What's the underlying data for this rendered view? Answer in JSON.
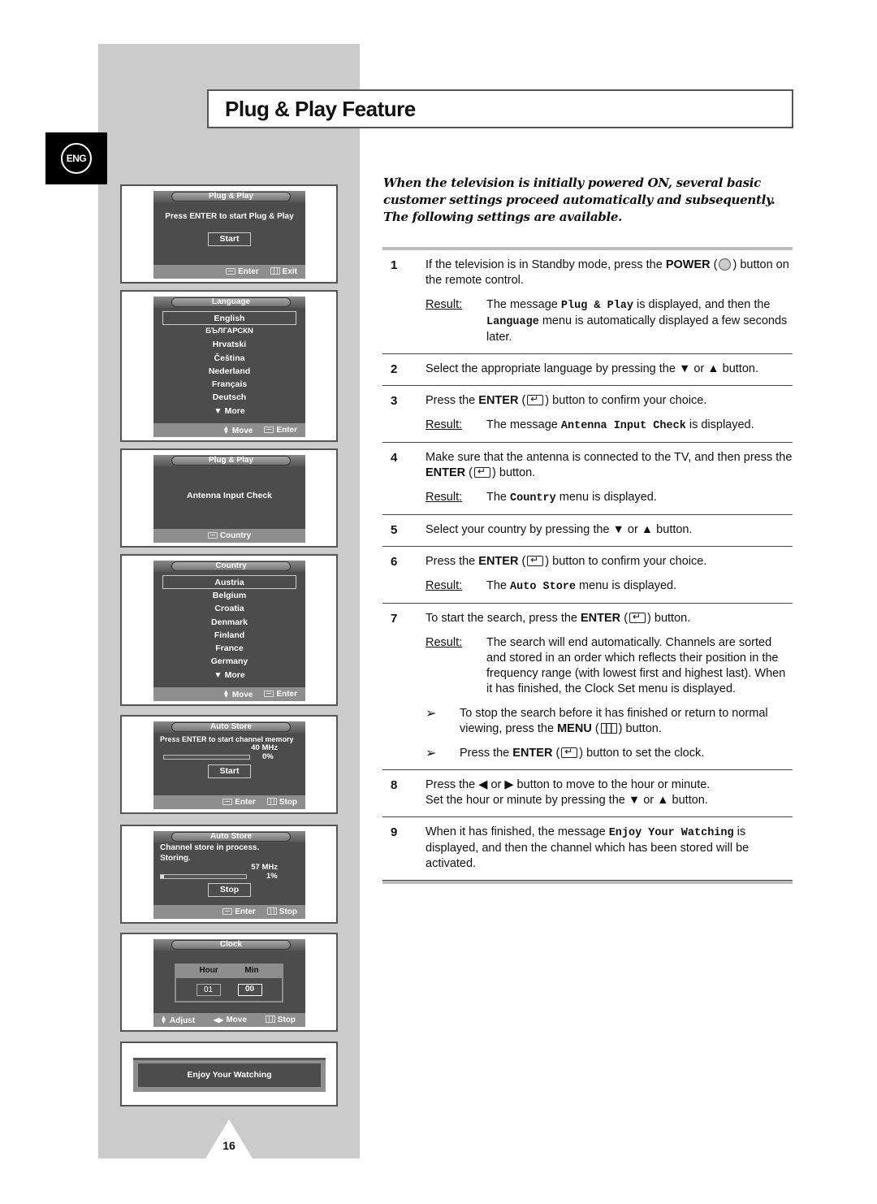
{
  "page": {
    "title": "Plug & Play Feature",
    "language_badge": "ENG",
    "page_number": "16"
  },
  "intro": "When the television is initially powered ON, several basic customer settings proceed automatically and subsequently. The following settings are available.",
  "screens": {
    "plug_play_start": {
      "title": "Plug & Play",
      "message": "Press ENTER to start Plug & Play",
      "button": "Start",
      "footer": [
        "Enter",
        "Exit"
      ]
    },
    "language": {
      "title": "Language",
      "items": [
        "English",
        "БЪЛГАРСКN",
        "Hrvatski",
        "Čeština",
        "Nederland",
        "Français",
        "Deutsch"
      ],
      "selected": "English",
      "more": "▼ More",
      "footer": [
        "Move",
        "Enter"
      ]
    },
    "antenna_check": {
      "title": "Plug & Play",
      "message": "Antenna Input Check",
      "footer": [
        "Country"
      ]
    },
    "country": {
      "title": "Country",
      "items": [
        "Austria",
        "Belgium",
        "Croatia",
        "Denmark",
        "Finland",
        "France",
        "Germany"
      ],
      "selected": "Austria",
      "more": "▼ More",
      "footer": [
        "Move",
        "Enter"
      ]
    },
    "auto_store_start": {
      "title": "Auto Store",
      "message": "Press ENTER to start channel memory",
      "frequency": "40 MHz",
      "progress_label": "0%",
      "progress": 0,
      "button": "Start",
      "footer": [
        "Enter",
        "Stop"
      ]
    },
    "auto_store_progress": {
      "title": "Auto Store",
      "message_line1": "Channel store in process.",
      "message_line2": "Storing.",
      "frequency": "57 MHz",
      "progress_label": "1%",
      "progress": 1,
      "button": "Stop",
      "footer": [
        "Enter",
        "Stop"
      ]
    },
    "clock": {
      "title": "Clock",
      "hour_label": "Hour",
      "min_label": "Min",
      "hour_value": "01",
      "min_value": "00",
      "footer": [
        "Adjust",
        "Move",
        "Stop"
      ]
    },
    "enjoy": {
      "message": "Enjoy Your Watching"
    }
  },
  "steps": [
    {
      "num": "1",
      "text_a": "If the television is in Standby mode, press the ",
      "bold": "POWER",
      "text_b": " button on the remote control.",
      "result_label": "Result:",
      "result_a": "The message ",
      "result_mono1": "Plug & Play",
      "result_b": " is displayed, and then the ",
      "result_mono2": "Language",
      "result_c": " menu is automatically displayed a few seconds later."
    },
    {
      "num": "2",
      "text": "Select the appropriate language by pressing the ▼ or ▲ button."
    },
    {
      "num": "3",
      "text_a": "Press the ",
      "bold": "ENTER",
      "text_b": " button to confirm your choice.",
      "result_label": "Result:",
      "result_a": "The message ",
      "result_mono": "Antenna Input Check",
      "result_b": " is displayed."
    },
    {
      "num": "4",
      "text_a": "Make sure that the antenna is connected to the TV, and then press the ",
      "bold": "ENTER",
      "text_b": " button.",
      "result_label": "Result:",
      "result_a": "The ",
      "result_mono": "Country",
      "result_b": " menu is displayed."
    },
    {
      "num": "5",
      "text": "Select your country by pressing the ▼ or ▲ button."
    },
    {
      "num": "6",
      "text_a": "Press the ",
      "bold": "ENTER",
      "text_b": " button to confirm your choice.",
      "result_label": "Result:",
      "result_a": "The ",
      "result_mono": "Auto Store",
      "result_b": " menu is displayed."
    },
    {
      "num": "7",
      "text_a": "To start the search, press the ",
      "bold": "ENTER",
      "text_b": " button.",
      "result_label": "Result:",
      "result": "The search will end automatically. Channels are sorted and stored in an order which reflects their position in the frequency range (with lowest first and highest last). When it has finished, the Clock Set menu is displayed.",
      "note1_a": "To stop the search before it has finished or return to normal viewing, press the ",
      "note1_bold": "MENU",
      "note1_b": " button.",
      "note2_a": "Press the ",
      "note2_bold": "ENTER",
      "note2_b": " button to set the clock."
    },
    {
      "num": "8",
      "text_line1": "Press the ◀ or ▶ button to move to the hour or minute.",
      "text_line2": "Set the hour or minute by pressing the ▼ or ▲ button."
    },
    {
      "num": "9",
      "text_a": "When it has finished, the message ",
      "mono": "Enjoy Your Watching",
      "text_b": " is displayed, and then the channel which has been stored will be activated."
    }
  ]
}
